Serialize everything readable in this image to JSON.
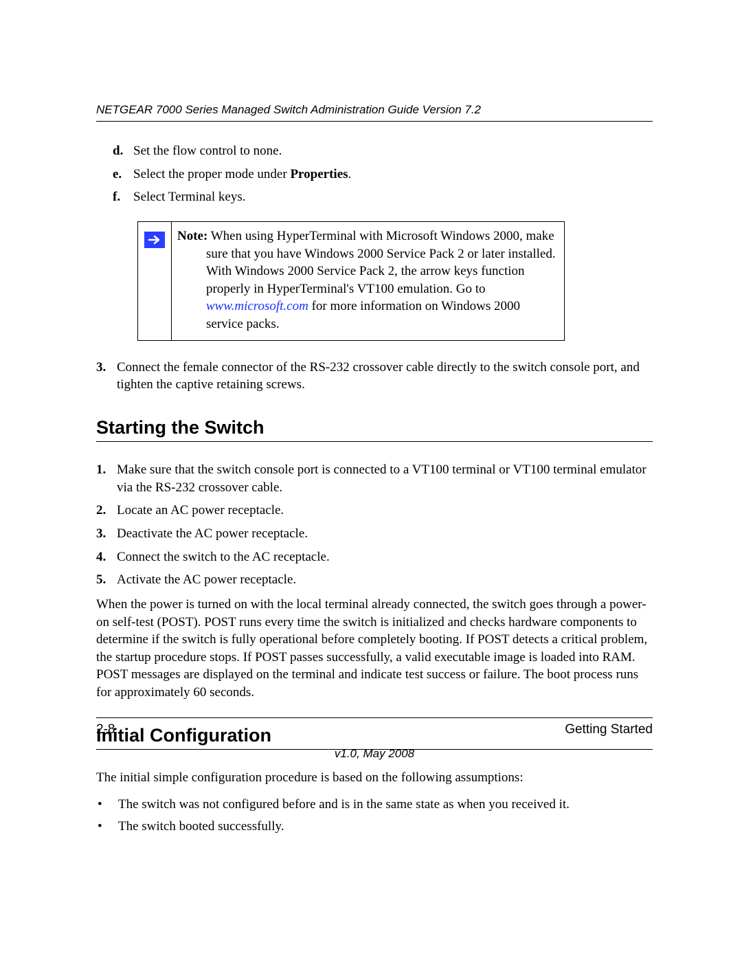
{
  "header": {
    "title": "NETGEAR 7000 Series Managed Switch Administration Guide Version 7.2"
  },
  "letters": {
    "d": {
      "marker": "d.",
      "text": "Set the flow control to none."
    },
    "e": {
      "marker": "e.",
      "pre": "Select the proper mode under ",
      "bold": "Properties",
      "post": "."
    },
    "f": {
      "marker": "f.",
      "text": "Select Terminal keys."
    }
  },
  "note": {
    "label": "Note:",
    "text_pre": " When using HyperTerminal with Microsoft Windows 2000, make sure that you have Windows 2000 Service Pack 2 or later installed. With Windows 2000 Service Pack 2, the arrow keys function properly in HyperTerminal's VT100 emulation. Go to ",
    "link": "www.microsoft.com",
    "text_post": " for more information on Windows 2000 service packs."
  },
  "step3": {
    "marker": "3.",
    "text": "Connect the female connector of the RS-232 crossover cable directly to the switch console port, and tighten the captive retaining screws."
  },
  "sections": {
    "starting": "Starting the Switch",
    "initial": "Initial Configuration"
  },
  "starting_steps": {
    "s1": {
      "marker": "1.",
      "text": "Make sure that the switch console port is connected to a VT100 terminal or VT100 terminal emulator via the RS-232 crossover cable."
    },
    "s2": {
      "marker": "2.",
      "text": "Locate an AC power receptacle."
    },
    "s3": {
      "marker": "3.",
      "text": "Deactivate the AC power receptacle."
    },
    "s4": {
      "marker": "4.",
      "text": "Connect the switch to the AC receptacle."
    },
    "s5": {
      "marker": "5.",
      "text": "Activate the AC power receptacle."
    }
  },
  "starting_para": "When the power is turned on with the local terminal already connected, the switch goes through a power-on self-test (POST). POST runs every time the switch is initialized and checks hardware components to determine if the switch is fully operational before completely booting. If POST detects a critical problem, the startup procedure stops. If POST passes successfully, a valid executable image is loaded into RAM. POST messages are displayed on the terminal and indicate test success or failure. The boot process runs for approximately 60 seconds.",
  "initial_intro": "The initial simple configuration procedure is based on the following assumptions:",
  "initial_bullets": {
    "b1": "The switch was not configured before and is in the same state as when you received it.",
    "b2": "The switch booted successfully."
  },
  "footer": {
    "page": "2-8",
    "section": "Getting Started",
    "version": "v1.0, May 2008"
  }
}
